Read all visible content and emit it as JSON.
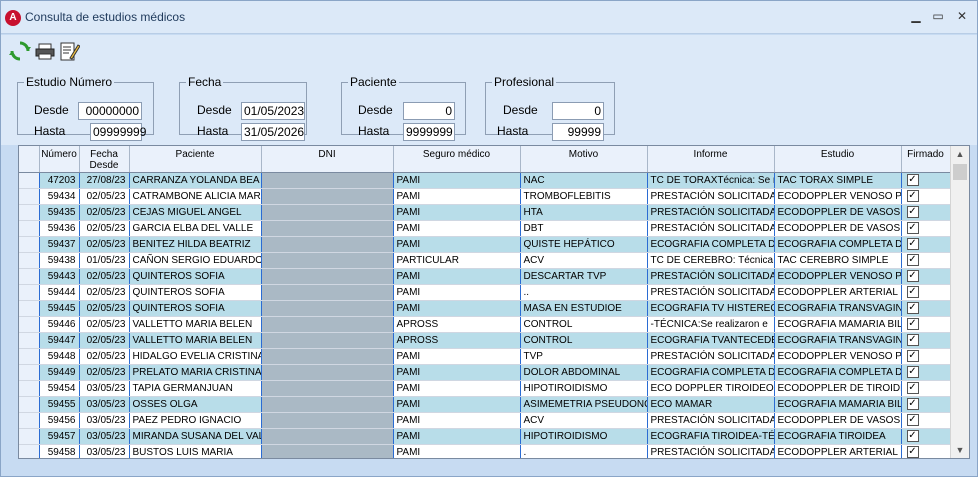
{
  "window": {
    "title": "Consulta de estudios médicos",
    "logo_letter": "A",
    "minimize_glyph": "▁",
    "maximize_glyph": "▭",
    "close_glyph": "✕"
  },
  "toolbar": {
    "icons": [
      "refresh-icon",
      "print-icon",
      "edit-report-icon"
    ]
  },
  "filters": {
    "estudio": {
      "legend": "Estudio Número",
      "desde_label": "Desde",
      "desde": "00000000",
      "hasta_label": "Hasta",
      "hasta": "09999999"
    },
    "fecha": {
      "legend": "Fecha",
      "desde_label": "Desde",
      "desde": "01/05/2023",
      "hasta_label": "Hasta",
      "hasta": "31/05/2026"
    },
    "paciente": {
      "legend": "Paciente",
      "desde_label": "Desde",
      "desde": "0",
      "hasta_label": "Hasta",
      "hasta": "9999999"
    },
    "profesional": {
      "legend": "Profesional",
      "desde_label": "Desde",
      "desde": "0",
      "hasta_label": "Hasta",
      "hasta": "99999"
    }
  },
  "grid": {
    "columns": [
      "Número",
      "Fecha Desde",
      "Paciente",
      "DNI",
      "Seguro médico",
      "Motivo",
      "Informe",
      "Estudio",
      "Firmado"
    ],
    "rows": [
      {
        "numero": "47203",
        "fecha": "27/08/23",
        "paciente": "CARRANZA YOLANDA BEA",
        "seguro": "PAMI",
        "motivo": "NAC",
        "informe": "TC DE TORAXTécnica: Se re",
        "estudio": "TAC  TORAX SIMPLE",
        "firmado": true
      },
      {
        "numero": "59434",
        "fecha": "02/05/23",
        "paciente": "CATRAMBONE ALICIA MAR",
        "seguro": "PAMI",
        "motivo": "TROMBOFLEBITIS",
        "informe": "PRESTACIÓN SOLICITADA:",
        "estudio": "ECODOPPLER VENOSO PR",
        "firmado": true
      },
      {
        "numero": "59435",
        "fecha": "02/05/23",
        "paciente": "CEJAS MIGUEL ANGEL",
        "seguro": "PAMI",
        "motivo": "HTA",
        "informe": "PRESTACIÓN SOLICITADA:",
        "estudio": "ECODOPPLER DE VASOS D",
        "firmado": true
      },
      {
        "numero": "59436",
        "fecha": "02/05/23",
        "paciente": "GARCIA ELBA DEL VALLE",
        "seguro": "PAMI",
        "motivo": "DBT",
        "informe": "PRESTACIÓN SOLICITADA:",
        "estudio": "ECODOPPLER DE VASOS D",
        "firmado": true
      },
      {
        "numero": "59437",
        "fecha": "02/05/23",
        "paciente": "BENITEZ HILDA BEATRIZ",
        "seguro": "PAMI",
        "motivo": "QUISTE HEPÁTICO",
        "informe": "ECOGRAFIA COMPLETA DE",
        "estudio": "ECOGRAFIA COMPLETA DE",
        "firmado": true
      },
      {
        "numero": "59438",
        "fecha": "01/05/23",
        "paciente": "CAÑON SERGIO EDUARDO",
        "seguro": "PARTICULAR",
        "motivo": "ACV",
        "informe": "TC DE CEREBRO: Técnica: s",
        "estudio": "TAC CEREBRO SIMPLE",
        "firmado": true
      },
      {
        "numero": "59443",
        "fecha": "02/05/23",
        "paciente": "QUINTEROS SOFIA",
        "seguro": "PAMI",
        "motivo": "DESCARTAR TVP",
        "informe": "PRESTACIÓN SOLICITADA:",
        "estudio": "ECODOPPLER VENOSO PR",
        "firmado": true
      },
      {
        "numero": "59444",
        "fecha": "02/05/23",
        "paciente": "QUINTEROS SOFIA",
        "seguro": "PAMI",
        "motivo": "..",
        "informe": "PRESTACIÓN SOLICITADA:",
        "estudio": "ECODOPPLER ARTERIAL D",
        "firmado": true
      },
      {
        "numero": "59445",
        "fecha": "02/05/23",
        "paciente": "QUINTEROS SOFIA",
        "seguro": "PAMI",
        "motivo": "MASA EN ESTUDIOE",
        "informe": "ECOGRAFIA TV HISTERECT",
        "estudio": "ECOGRAFIA TRANSVAGINA",
        "firmado": true
      },
      {
        "numero": "59446",
        "fecha": "02/05/23",
        "paciente": "VALLETTO MARIA BELEN",
        "seguro": "APROSS",
        "motivo": "CONTROL",
        "informe": "-TÉCNICA:Se realizaron e",
        "estudio": "ECOGRAFIA MAMARIA BIL",
        "firmado": true
      },
      {
        "numero": "59447",
        "fecha": "02/05/23",
        "paciente": "VALLETTO MARIA BELEN",
        "seguro": "APROSS",
        "motivo": "CONTROL",
        "informe": "ECOGRAFIA  TVANTECEDE",
        "estudio": "ECOGRAFIA TRANSVAGINA",
        "firmado": true
      },
      {
        "numero": "59448",
        "fecha": "02/05/23",
        "paciente": "HIDALGO EVELIA CRISTINA",
        "seguro": "PAMI",
        "motivo": "TVP",
        "informe": "PRESTACIÓN SOLICITADA:",
        "estudio": "ECODOPPLER VENOSO PR",
        "firmado": true
      },
      {
        "numero": "59449",
        "fecha": "02/05/23",
        "paciente": "PRELATO MARIA CRISTINA",
        "seguro": "PAMI",
        "motivo": "DOLOR ABDOMINAL",
        "informe": "ECOGRAFIA COMPLETA DE",
        "estudio": "ECOGRAFIA COMPLETA DE",
        "firmado": true
      },
      {
        "numero": "59454",
        "fecha": "03/05/23",
        "paciente": "TAPIA GERMANJUAN",
        "seguro": "PAMI",
        "motivo": "HIPOTIROIDISMO",
        "informe": "ECO DOPPLER TIROIDEO-T",
        "estudio": "ECODOPPLER DE TIROIDES",
        "firmado": true
      },
      {
        "numero": "59455",
        "fecha": "03/05/23",
        "paciente": "OSSES OLGA",
        "seguro": "PAMI",
        "motivo": "ASIMEMETRIA PSEUDONO",
        "informe": "ECO MAMAR",
        "estudio": "ECOGRAFIA MAMARIA BIL",
        "firmado": true
      },
      {
        "numero": "59456",
        "fecha": "03/05/23",
        "paciente": "PAEZ PEDRO IGNACIO",
        "seguro": "PAMI",
        "motivo": "ACV",
        "informe": "PRESTACIÓN SOLICITADA:",
        "estudio": "ECODOPPLER DE VASOS D",
        "firmado": true
      },
      {
        "numero": "59457",
        "fecha": "03/05/23",
        "paciente": "MIRANDA SUSANA DEL VAL",
        "seguro": "PAMI",
        "motivo": "HIPOTIROIDISMO",
        "informe": "ECOGRAFIA  TIROIDEA-TÉC",
        "estudio": "ECOGRAFIA TIROIDEA",
        "firmado": true
      },
      {
        "numero": "59458",
        "fecha": "03/05/23",
        "paciente": "BUSTOS LUIS MARIA",
        "seguro": "PAMI",
        "motivo": ".",
        "informe": "PRESTACIÓN SOLICITADA:",
        "estudio": "ECODOPPLER ARTERIAL D",
        "firmado": true
      }
    ]
  },
  "scrollbar": {
    "up_glyph": "▲",
    "down_glyph": "▼"
  }
}
